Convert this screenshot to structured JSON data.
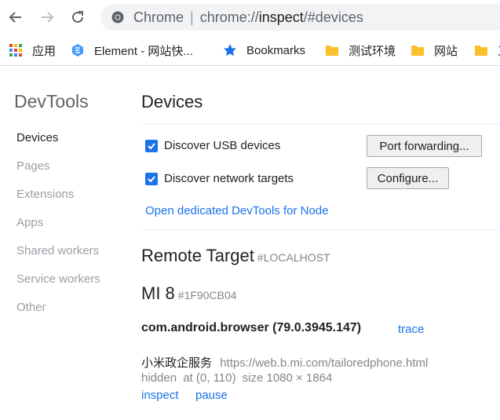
{
  "browser": {
    "back_icon": "arrow-left-icon",
    "forward_icon": "arrow-right-icon",
    "reload_icon": "reload-icon",
    "omnibox": {
      "site_label": "Chrome",
      "separator": "|",
      "url_scheme": "chrome://",
      "url_host": "inspect",
      "url_rest": "/#devices"
    }
  },
  "bookmarks": [
    {
      "label": "应用",
      "icon": "apps-grid-icon"
    },
    {
      "label": "Element - 网站快...",
      "icon": "element-logo-icon"
    },
    {
      "label": "Bookmarks",
      "icon": "star-icon"
    },
    {
      "label": "测试环境",
      "icon": "folder-icon"
    },
    {
      "label": "网站",
      "icon": "folder-icon"
    },
    {
      "label": "工",
      "icon": "folder-icon"
    }
  ],
  "sidebar": {
    "title": "DevTools",
    "items": [
      {
        "label": "Devices",
        "active": true
      },
      {
        "label": "Pages",
        "active": false
      },
      {
        "label": "Extensions",
        "active": false
      },
      {
        "label": "Apps",
        "active": false
      },
      {
        "label": "Shared workers",
        "active": false
      },
      {
        "label": "Service workers",
        "active": false
      },
      {
        "label": "Other",
        "active": false
      }
    ]
  },
  "main": {
    "heading": "Devices",
    "discover_usb": {
      "label": "Discover USB devices",
      "checked": true
    },
    "discover_network": {
      "label": "Discover network targets",
      "checked": true
    },
    "port_forwarding_button": "Port forwarding...",
    "configure_button": "Configure...",
    "node_link": "Open dedicated DevTools for Node",
    "remote_target": {
      "label": "Remote Target",
      "sub": "#LOCALHOST"
    },
    "device": {
      "name": "MI 8",
      "serial": "#1F90CB04"
    },
    "browser_package": "com.android.browser (79.0.3945.147)",
    "trace_link": "trace",
    "page": {
      "title": "小米政企服务",
      "url": "https://web.b.mi.com/tailoredphone.html",
      "status": "hidden",
      "position_text": "at (0, 110)",
      "size_text": "size 1080 × 1864"
    },
    "inspect_link": "inspect",
    "pause_link": "pause"
  },
  "colors": {
    "accent": "#1a73e8",
    "folder": "#fbc02d",
    "star": "#1a73e8"
  }
}
